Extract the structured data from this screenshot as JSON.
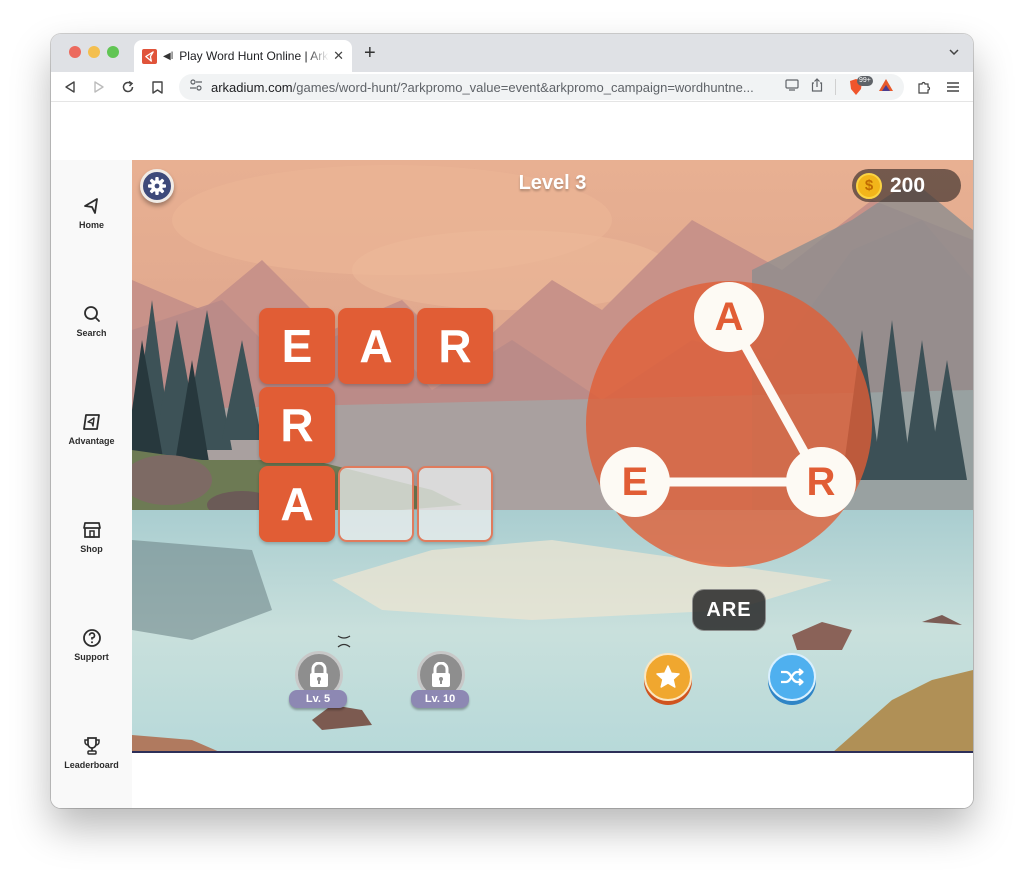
{
  "browser": {
    "tab": {
      "title": "Play Word Hunt Online | Arkadium",
      "favicon": "arkadium-logo-icon",
      "audio": "speaker-icon"
    },
    "url": {
      "host": "arkadium.com",
      "path": "/games/word-hunt/?arkpromo_value=event&arkpromo_campaign=wordhuntne..."
    },
    "extensions": {
      "brave_badge": "99+"
    }
  },
  "sidebar": {
    "items": [
      {
        "label": "Home",
        "icon": "home-arrow-icon"
      },
      {
        "label": "Search",
        "icon": "search-icon"
      },
      {
        "label": "Advantage",
        "icon": "advantage-icon"
      },
      {
        "label": "Shop",
        "icon": "shop-icon"
      },
      {
        "label": "Support",
        "icon": "help-circle-icon"
      },
      {
        "label": "Leaderboard",
        "icon": "trophy-icon"
      }
    ]
  },
  "game": {
    "level_title": "Level 3",
    "coins": "200",
    "coin_symbol": "$",
    "grid": {
      "rows": [
        [
          "E",
          "A",
          "R"
        ],
        [
          "R",
          null,
          null
        ],
        [
          "A",
          "",
          ""
        ]
      ]
    },
    "wheel": {
      "letters": [
        "A",
        "E",
        "R"
      ],
      "selected_path": [
        "A",
        "R",
        "E"
      ]
    },
    "current_word": "ARE",
    "boosters": {
      "hint": {
        "icon": "star-icon"
      },
      "shuffle": {
        "icon": "shuffle-icon"
      },
      "locked": [
        {
          "label": "Lv. 5"
        },
        {
          "label": "Lv. 10"
        }
      ]
    },
    "colors": {
      "tile": "#e15d35",
      "hint_button": "#f0a72f",
      "shuffle_button": "#4fb0ef",
      "settings_button": "#3e4a7a"
    }
  }
}
